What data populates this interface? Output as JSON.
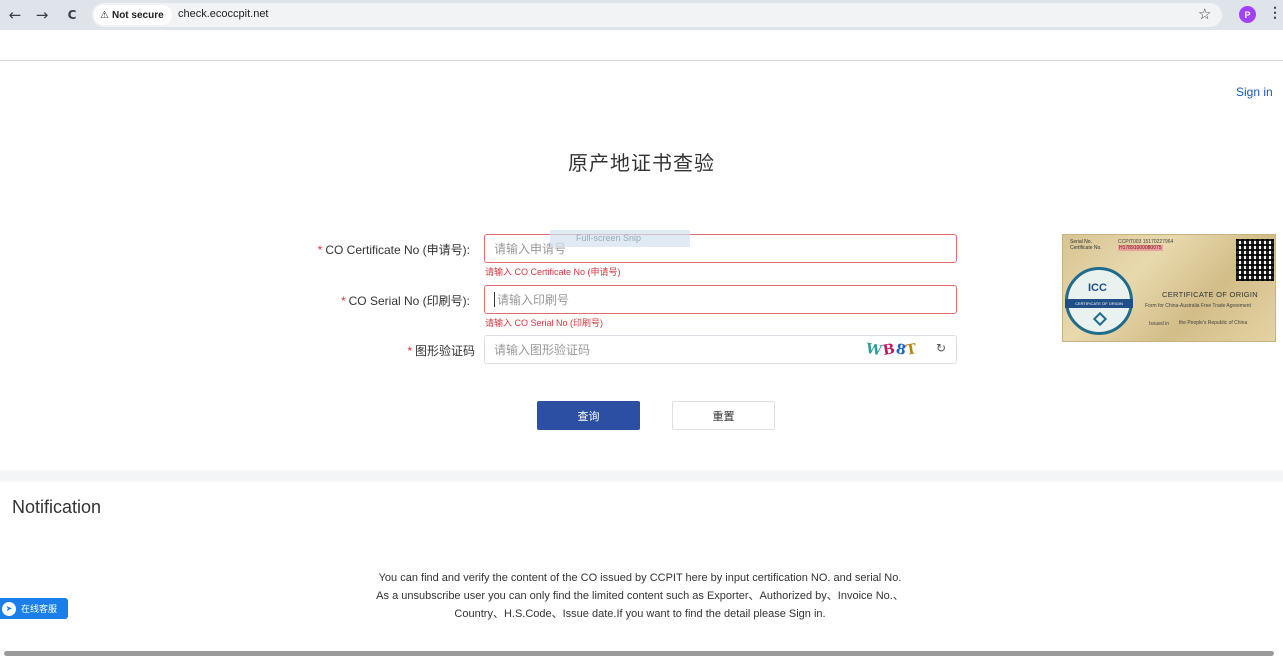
{
  "browser": {
    "back_icon": "←",
    "forward_icon": "→",
    "reload_icon": "C",
    "security_label": "Not secure",
    "url": "check.ecoccpit.net",
    "bookmark_icon": "☆",
    "profile_initial": "P",
    "menu_icon": "⋮"
  },
  "header": {
    "sign_in": "Sign in"
  },
  "page_title": "原产地证书查验",
  "overlay": {
    "snip_text": "Full-screen Snip"
  },
  "form": {
    "required_mark": "*",
    "certificate_no": {
      "label": "CO Certificate No (申请号):",
      "placeholder": "请输入申请号",
      "error": "请输入 CO Certificate No (申请号)"
    },
    "serial_no": {
      "label": "CO Serial No (印刷号):",
      "placeholder": "请输入印刷号",
      "error": "请输入 CO Serial No (印刷号)"
    },
    "captcha": {
      "label": "图形验证码",
      "placeholder": "请输入图形验证码",
      "chars": [
        "W",
        "B",
        "8",
        "T"
      ],
      "colors": [
        "#2aa198",
        "#c2185b",
        "#1565c0",
        "#b8860b"
      ],
      "refresh_icon": "↻"
    },
    "query_button": "查询",
    "reset_button": "重置"
  },
  "certificate_image": {
    "serial_label": "Serial No.",
    "certificate_label": "Certificate No.",
    "serial_value": "CCPIT003 15170227964",
    "certificate_value": "H17891000080075",
    "seal_text": "ICC",
    "seal_band": "CERTIFICATE OF ORIGIN",
    "title": "CERTIFICATE OF ORIGIN",
    "line1": "Form for China-Australia Free Trade Agreement",
    "line2": "Issued in",
    "line3": "the People's Republic of China"
  },
  "notification": {
    "title": "Notification",
    "line1": "You can find and verify the content of the CO issued by CCPIT here by input certification NO. and serial No.",
    "line2": "As a unsubscribe user you can only find the limited content such as Exporter、Authorized by、Invoice No.、",
    "line3": "Country、H.S.Code、Issue date.If you want to find the detail please Sign in."
  },
  "support": {
    "icon": "➤",
    "label": "在线客服"
  }
}
